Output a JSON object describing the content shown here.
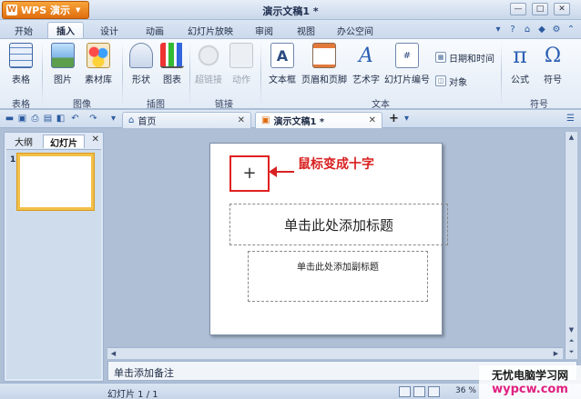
{
  "app": {
    "name": "WPS 演示",
    "logo": "W"
  },
  "window": {
    "title": "演示文稿1 *"
  },
  "menu": {
    "tabs": [
      "开始",
      "插入",
      "设计",
      "动画",
      "幻灯片放映",
      "审阅",
      "视图",
      "办公空间"
    ],
    "active": "插入"
  },
  "ribbon": {
    "groups": {
      "table": {
        "label": "表格",
        "buttons": [
          "表格"
        ]
      },
      "image": {
        "label": "图像",
        "buttons": [
          "图片",
          "素材库"
        ]
      },
      "illustration": {
        "label": "插图",
        "buttons": [
          "形状",
          "图表"
        ]
      },
      "link": {
        "label": "链接",
        "buttons": [
          "超链接",
          "动作"
        ]
      },
      "text": {
        "label": "文本",
        "buttons": [
          "文本框",
          "页眉和页脚",
          "艺术字",
          "幻灯片编号"
        ],
        "small": [
          "日期和时间",
          "对象"
        ]
      },
      "symbol": {
        "label": "符号",
        "buttons": [
          "公式",
          "符号"
        ],
        "glyphs": [
          "π",
          "Ω"
        ]
      }
    }
  },
  "doc_tabs": [
    {
      "label": "首页",
      "active": false
    },
    {
      "label": "演示文稿1 *",
      "active": true
    }
  ],
  "left_panel": {
    "tabs": [
      "大纲",
      "幻灯片"
    ],
    "active": "幻灯片",
    "thumb_number": "1"
  },
  "slide": {
    "title_placeholder": "单击此处添加标题",
    "subtitle_placeholder": "单击此处添加副标题",
    "annotation": "鼠标变成十字",
    "cursor": "+"
  },
  "notes": {
    "placeholder": "单击添加备注"
  },
  "status": {
    "slide_info": "幻灯片 1 / 1",
    "zoom": "36 %"
  },
  "watermark": {
    "title": "无忧电脑学习网",
    "url": "wypcw.com"
  }
}
